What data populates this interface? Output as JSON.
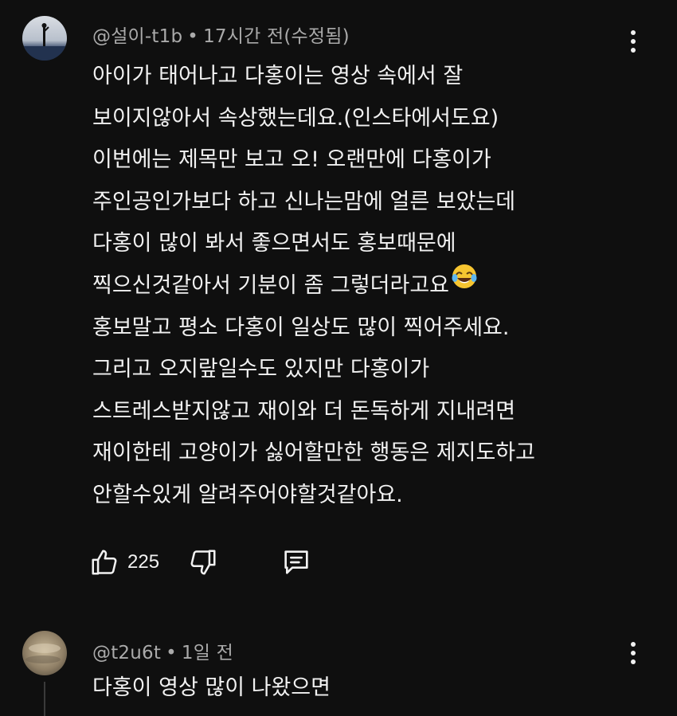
{
  "comments": [
    {
      "author": "@설이-t1b",
      "separator": "•",
      "time": "17시간 전(수정됨)",
      "lines": [
        "아이가 태어나고 다홍이는 영상 속에서 잘",
        "보이지않아서 속상했는데요.(인스타에서도요)",
        "이번에는 제목만 보고 오! 오랜만에 다홍이가",
        "주인공인가보다 하고 신나는맘에 얼른 보았는데",
        "다홍이 많이 봐서 좋으면서도  홍보때문에",
        "찍으신것같아서 기분이 좀 그렇더라고요",
        "홍보말고 평소 다홍이 일상도 많이 찍어주세요.",
        "그리고 오지랖일수도 있지만 다홍이가",
        "스트레스받지않고 재이와 더 돈독하게 지내려면",
        "재이한테 고양이가 싫어할만한 행동은 제지도하고",
        "안할수있게 알려주어야할것같아요."
      ],
      "emoji": "face-with-tears-of-joy",
      "like_count": "225",
      "icons": {
        "like": "thumbs-up-icon",
        "dislike": "thumbs-down-icon",
        "reply": "reply-comment-icon",
        "more": "more-vertical-icon"
      }
    },
    {
      "author": "@t2u6t",
      "separator": "•",
      "time": "1일 전",
      "lines": [
        "다홍이 영상 많이 나왔으면"
      ]
    }
  ]
}
